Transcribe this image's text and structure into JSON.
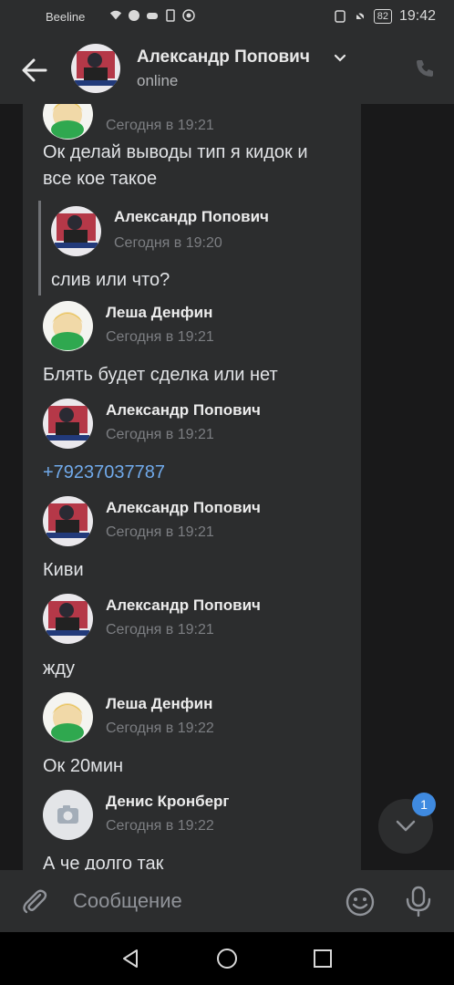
{
  "status_bar": {
    "carrier": "Beeline",
    "battery": "82",
    "time": "19:42"
  },
  "header": {
    "name": "Александр Попович",
    "status": "online"
  },
  "quote": {
    "sender": "Александр Попович",
    "time": "Сегодня в 19:20",
    "text": "слив или что?"
  },
  "messages": [
    {
      "sender": "",
      "time": "Сегодня в 19:21",
      "text": "Ок делай выводы тип я кидок и",
      "text2": "все кое такое",
      "avatar": "anime-avatar"
    },
    {
      "sender": "Леша Денфин",
      "time": "Сегодня в 19:21",
      "text": "Блять будет сделка или нет",
      "avatar": "anime-avatar"
    },
    {
      "sender": "Александр Попович",
      "time": "Сегодня в 19:21",
      "text": "+79237037787",
      "avatar": "photo-avatar"
    },
    {
      "sender": "Александр Попович",
      "time": "Сегодня в 19:21",
      "text": "Киви",
      "avatar": "photo-avatar"
    },
    {
      "sender": "Александр Попович",
      "time": "Сегодня в 19:21",
      "text": "жду",
      "avatar": "photo-avatar"
    },
    {
      "sender": "Леша Денфин",
      "time": "Сегодня в 19:22",
      "text": "Ок 20мин",
      "avatar": "anime-avatar"
    },
    {
      "sender": "Денис Кронберг",
      "time": "Сегодня в 19:22",
      "text": "А че долго так",
      "avatar": "camera-placeholder-avatar"
    }
  ],
  "fab": {
    "badge": "1"
  },
  "composer": {
    "placeholder": "Сообщение"
  },
  "colors": {
    "background": "#19191a",
    "panel": "#2c2d2e",
    "link": "#71aaeb",
    "badge": "#3f8ae0"
  }
}
